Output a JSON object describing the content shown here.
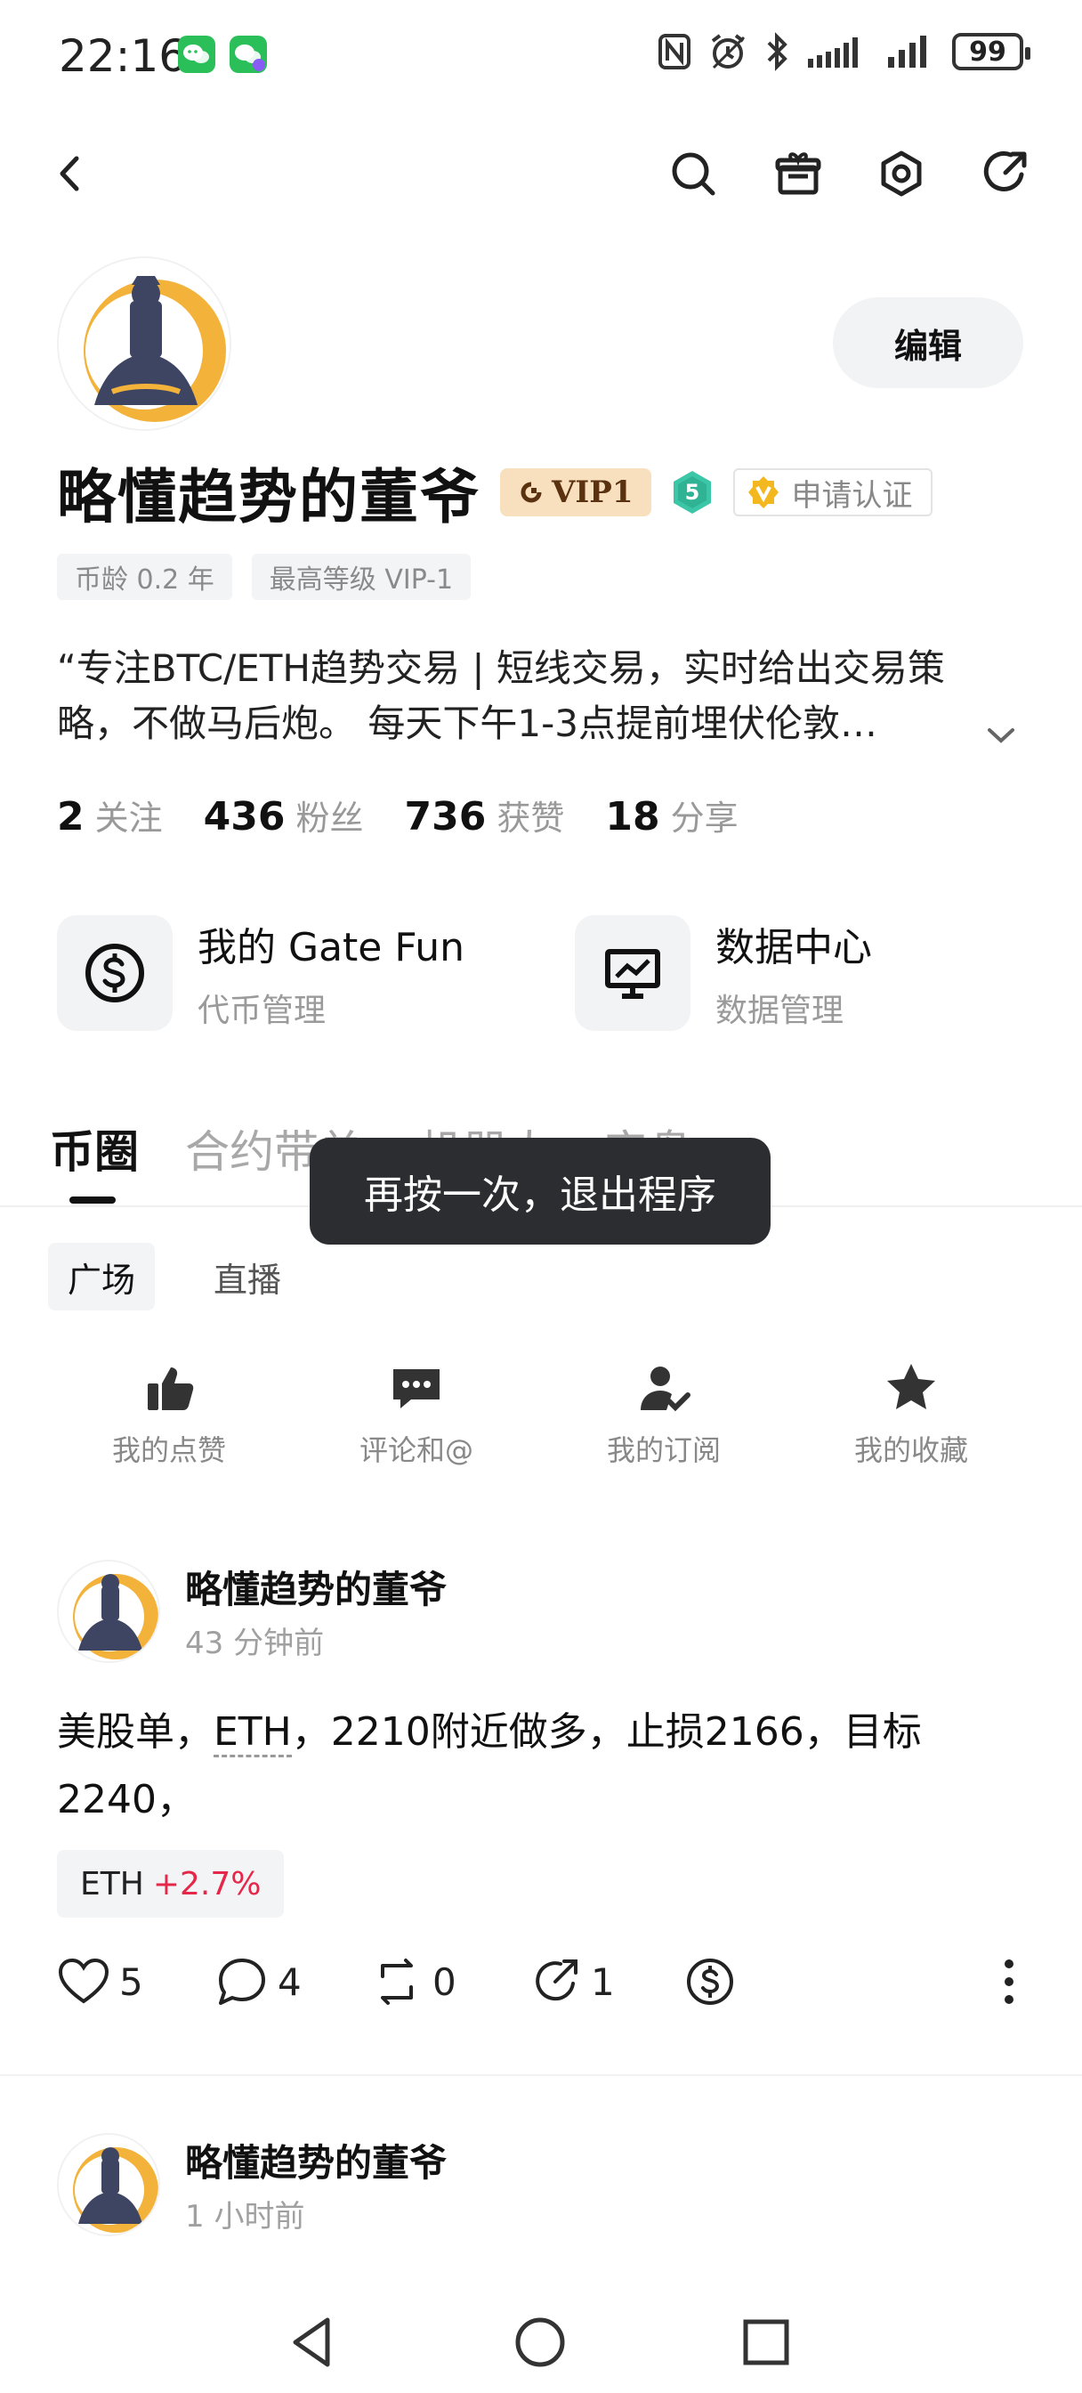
{
  "status_bar": {
    "time": "22:16",
    "battery": "99"
  },
  "profile": {
    "name": "略懂趋势的董爷",
    "vip_label": "VIP1",
    "level": "5",
    "verify_label": "申请认证",
    "edit_label": "编辑",
    "tags": [
      "币龄 0.2 年",
      "最高等级 VIP-1"
    ],
    "bio": "“专注BTC/ETH趋势交易 | 短线交易，实时给出交易策略，不做马后炮。 每天下午1-3点提前埋伏伦敦…",
    "stats": [
      {
        "num": "2",
        "label": "关注"
      },
      {
        "num": "436",
        "label": "粉丝"
      },
      {
        "num": "736",
        "label": "获赞"
      },
      {
        "num": "18",
        "label": "分享"
      }
    ]
  },
  "tools": [
    {
      "title": "我的 Gate Fun",
      "subtitle": "代币管理",
      "icon": "dollar-circle-icon"
    },
    {
      "title": "数据中心",
      "subtitle": "数据管理",
      "icon": "monitor-chart-icon"
    }
  ],
  "tabs": [
    "币圈",
    "合约带单",
    "机器人",
    "实盘"
  ],
  "toast": "再按一次，退出程序",
  "subtabs": [
    "广场",
    "直播"
  ],
  "quick_actions": [
    {
      "label": "我的点赞",
      "icon": "thumbs-up-icon"
    },
    {
      "label": "评论和@",
      "icon": "comment-icon"
    },
    {
      "label": "我的订阅",
      "icon": "subscribe-user-icon"
    },
    {
      "label": "我的收藏",
      "icon": "star-icon"
    }
  ],
  "posts": [
    {
      "author": "略懂趋势的董爷",
      "time": "43 分钟前",
      "content_before": "美股单，",
      "content_link": "ETH",
      "content_after": "，2210附近做多，止损2166，目标2240，",
      "coin": {
        "name": "ETH",
        "change": "+2.7%"
      },
      "likes": "5",
      "comments": "4",
      "reposts": "0",
      "shares": "1"
    },
    {
      "author": "略懂趋势的董爷",
      "time": "1 小时前"
    }
  ],
  "colors": {
    "accent_up": "#e5274a",
    "vip_bg": "#f8e0bf",
    "level_badge": "#3cc6a8",
    "verify_gold": "#f3b81f",
    "avatar_gold": "#f3b23a",
    "toast_bg": "#2b2d31"
  }
}
